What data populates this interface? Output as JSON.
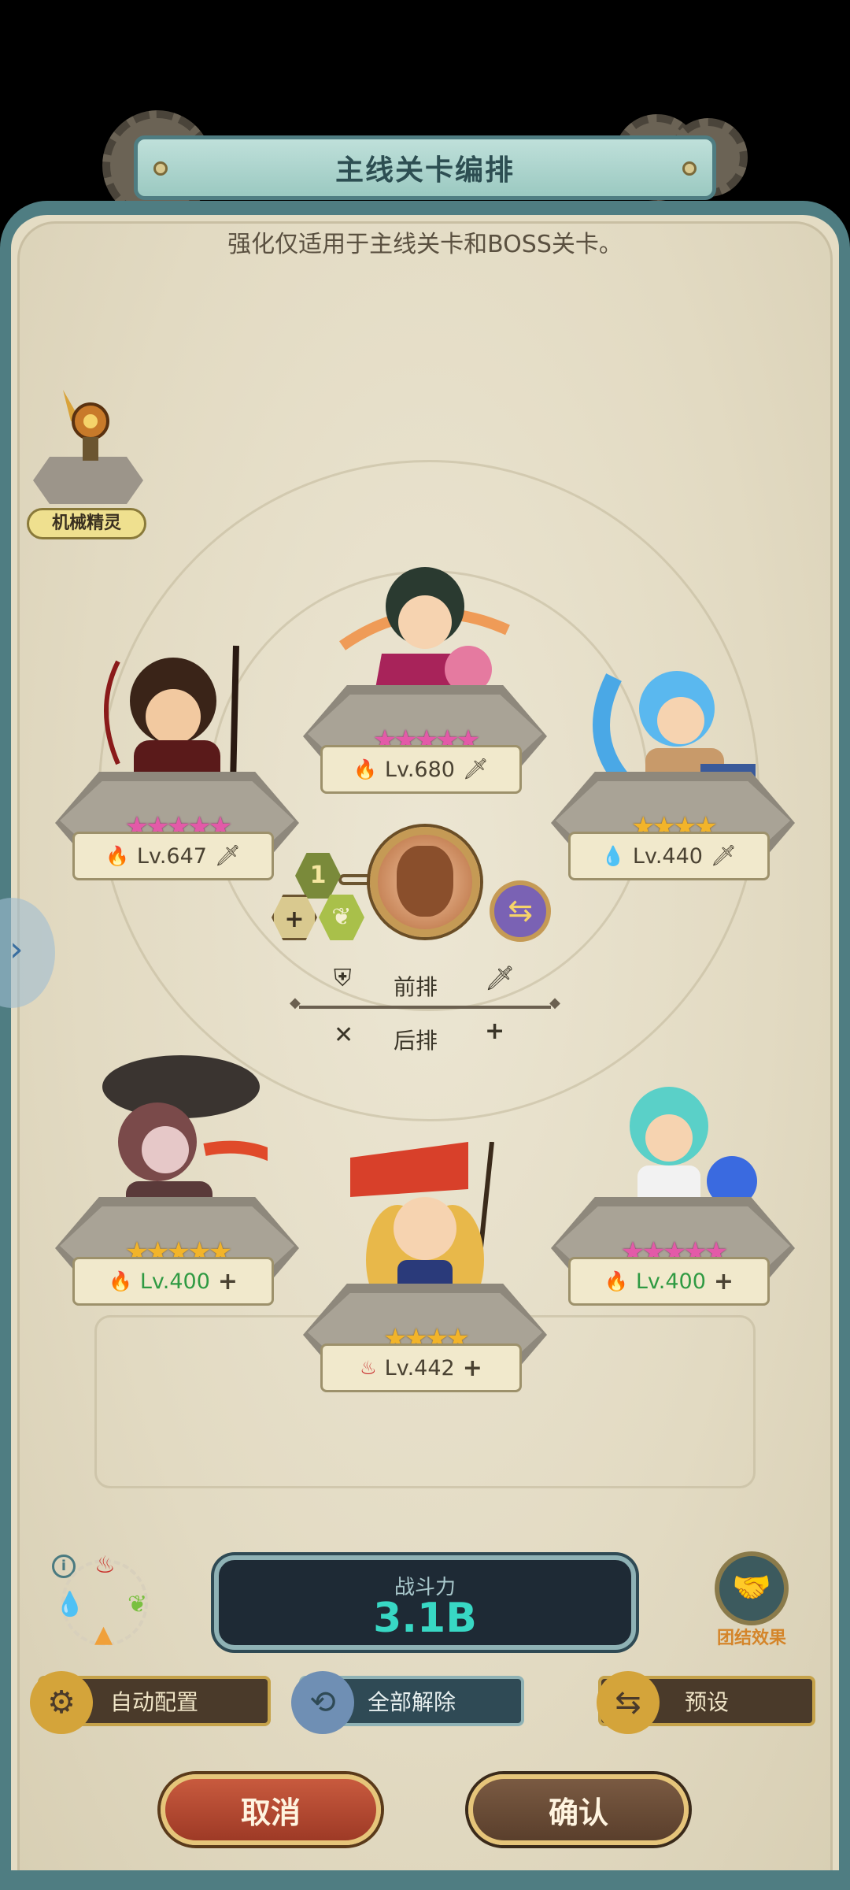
{
  "header": {
    "title": "主线关卡编排",
    "subtitle": "强化仅适用于主线关卡和BOSS关卡。"
  },
  "spirit": {
    "label": "机械精灵"
  },
  "heroes": [
    {
      "slot": "front-left",
      "stars": "★★★★★",
      "star_color": "pink",
      "element_icon": "fire-icon",
      "element": "🔥",
      "level": "Lv.647",
      "action": "sword"
    },
    {
      "slot": "front-center",
      "stars": "★★★★★",
      "star_color": "pink",
      "element_icon": "fire-icon",
      "element": "🔥",
      "level": "Lv.680",
      "action": "sword"
    },
    {
      "slot": "front-right",
      "stars": "★★★★",
      "star_color": "gold",
      "element_icon": "water-icon",
      "element": "💧",
      "level": "Lv.440",
      "action": "sword"
    },
    {
      "slot": "back-left",
      "stars": "★★★★★",
      "star_color": "gold",
      "element_icon": "fire-icon",
      "element": "🔥",
      "level": "Lv.400",
      "action": "plus"
    },
    {
      "slot": "back-center",
      "stars": "★★★★",
      "star_color": "gold",
      "element_icon": "flame-red-icon",
      "element": "♨",
      "level": "Lv.442",
      "action": "plus"
    },
    {
      "slot": "back-right",
      "stars": "★★★★★",
      "star_color": "pink",
      "element_icon": "fire-icon",
      "element": "🔥",
      "level": "Lv.400",
      "action": "plus"
    }
  ],
  "leader": {
    "badge": "1"
  },
  "rows": {
    "front": "前排",
    "back": "后排"
  },
  "power": {
    "label": "战斗力",
    "value": "3.1B"
  },
  "unity": {
    "label": "团结效果"
  },
  "buttons": {
    "auto": "自动配置",
    "clear": "全部解除",
    "preset": "预设",
    "cancel": "取消",
    "confirm": "确认"
  },
  "colors": {
    "panel_border": "#4f7d82",
    "power_value": "#38d8c4",
    "star_pink": "#e35aa8",
    "star_gold": "#f2b42a",
    "level_green": "#2f9a42"
  }
}
